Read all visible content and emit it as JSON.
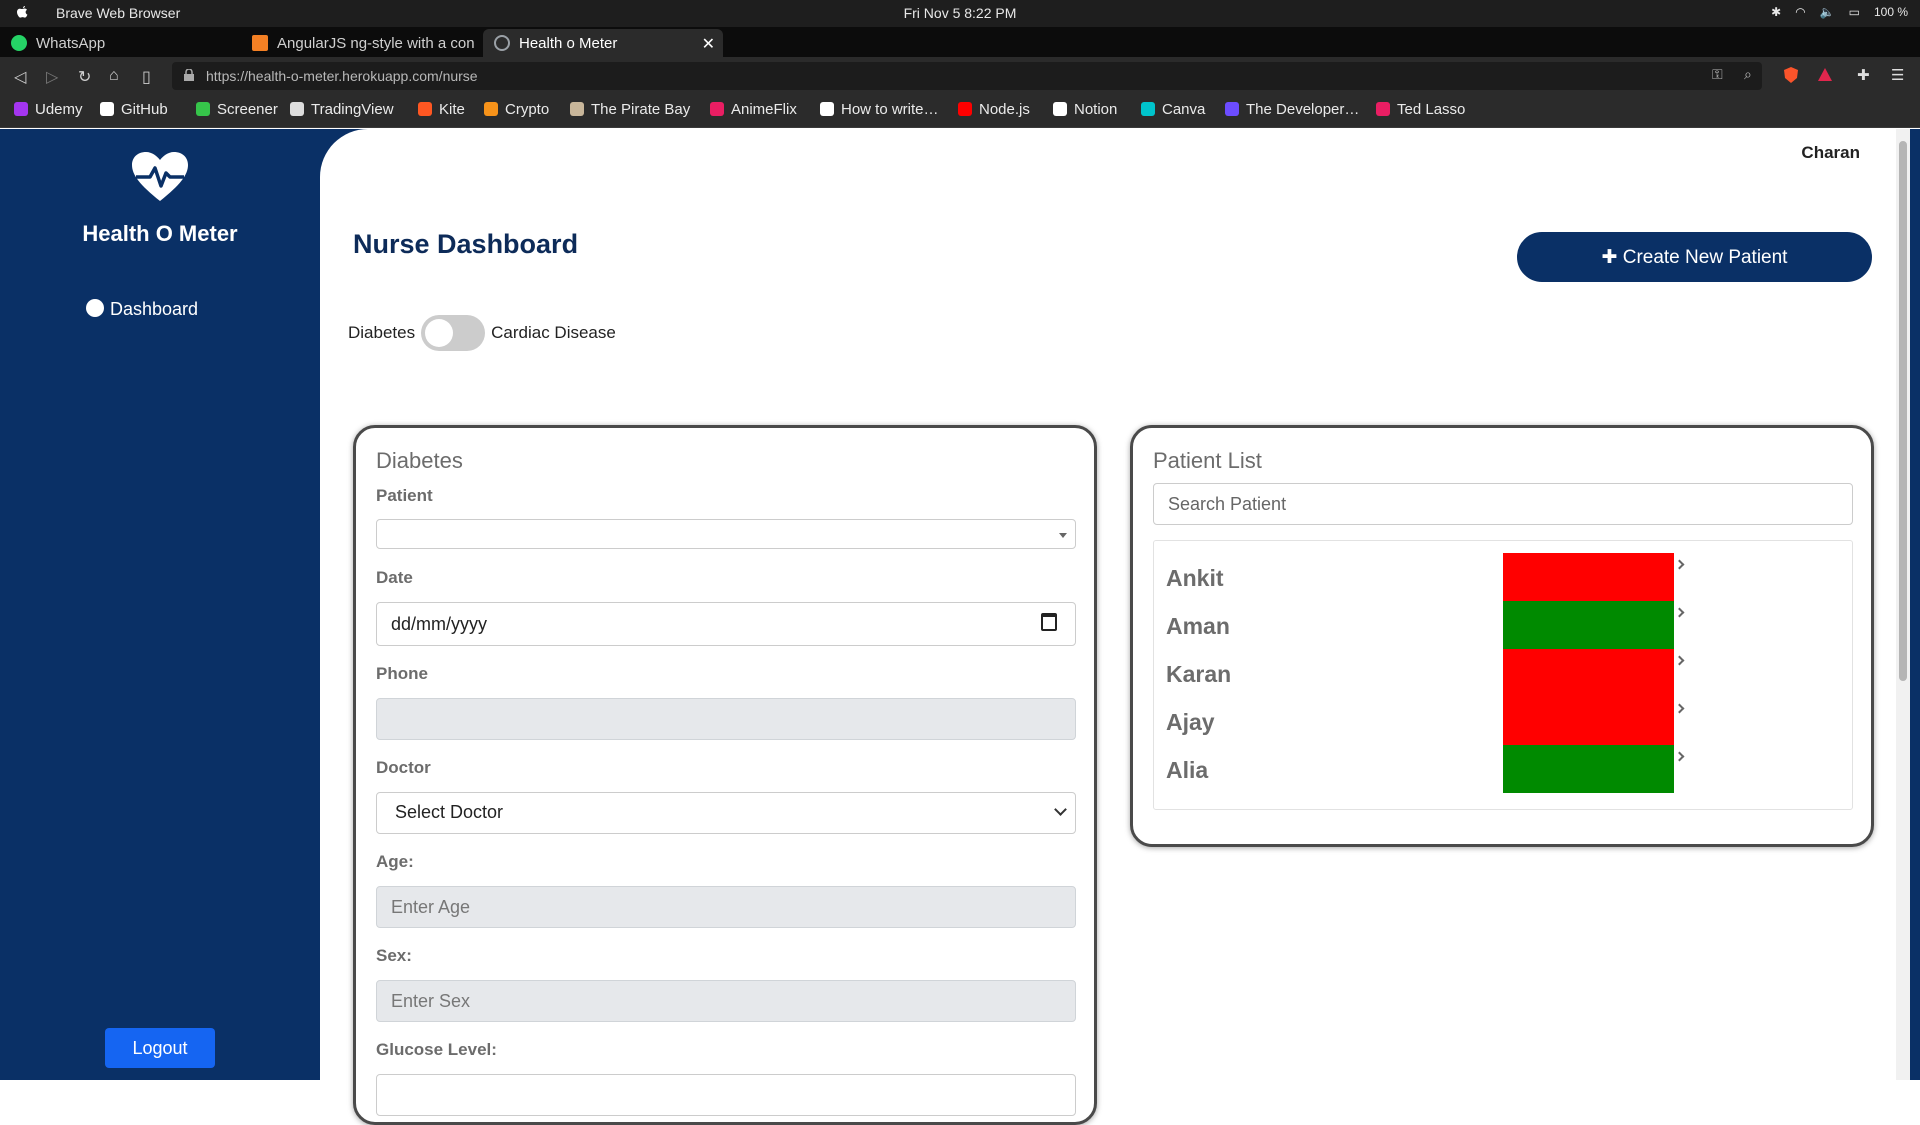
{
  "os_bar": {
    "app_name": "Brave Web Browser",
    "clock": "Fri Nov 5   8:22 PM",
    "battery": "100 %"
  },
  "tabs": [
    {
      "label": "WhatsApp",
      "icon": "whatsapp-icon",
      "color": "#25d366"
    },
    {
      "label": "AngularJS ng-style with a con",
      "icon": "stackoverflow-icon",
      "color": "#f48024"
    },
    {
      "label": "Health o Meter",
      "icon": "globe-icon",
      "color": "#9aa0a6"
    }
  ],
  "address_bar": {
    "url": "https://health-o-meter.herokuapp.com/nurse"
  },
  "bookmarks": [
    {
      "label": "Udemy",
      "color": "#a435f0"
    },
    {
      "label": "GitHub",
      "color": "#ffffff"
    },
    {
      "label": "Screener",
      "color": "#36c44a"
    },
    {
      "label": "TradingView",
      "color": "#dddddd"
    },
    {
      "label": "Kite",
      "color": "#ff5722"
    },
    {
      "label": "Crypto",
      "color": "#f7931a"
    },
    {
      "label": "The Pirate Bay",
      "color": "#c8b69a"
    },
    {
      "label": "AnimeFlix",
      "color": "#e91e63"
    },
    {
      "label": "How to write…",
      "color": "#ffffff"
    },
    {
      "label": "Node.js",
      "color": "#ff0000"
    },
    {
      "label": "Notion",
      "color": "#ffffff"
    },
    {
      "label": "Canva",
      "color": "#00c4cc"
    },
    {
      "label": "The Developer…",
      "color": "#6c4cff"
    },
    {
      "label": "Ted Lasso",
      "color": "#e91e63"
    }
  ],
  "sidebar": {
    "brand": "Health O Meter",
    "nav_dashboard": "Dashboard",
    "logout": "Logout"
  },
  "header": {
    "user": "Charan",
    "title": "Nurse Dashboard",
    "create_button": "Create New Patient"
  },
  "toggle": {
    "left_label": "Diabetes",
    "right_label": "Cardiac Disease",
    "state": "off"
  },
  "form": {
    "title": "Diabetes",
    "patient_label": "Patient",
    "patient_value": "",
    "date_label": "Date",
    "date_placeholder": "dd/mm/yyyy",
    "phone_label": "Phone",
    "phone_value": "",
    "doctor_label": "Doctor",
    "doctor_value": "Select Doctor",
    "age_label": "Age:",
    "age_placeholder": "Enter Age",
    "sex_label": "Sex:",
    "sex_placeholder": "Enter Sex",
    "glucose_label": "Glucose Level:"
  },
  "patient_list": {
    "title": "Patient List",
    "search_placeholder": "Search Patient",
    "patients": [
      {
        "name": "Ankit",
        "status_color": "#ff0000"
      },
      {
        "name": "Aman",
        "status_color": "#008a00"
      },
      {
        "name": "Karan",
        "status_color": "#ff0000"
      },
      {
        "name": "Ajay",
        "status_color": "#ff0000"
      },
      {
        "name": "Alia",
        "status_color": "#008a00"
      }
    ]
  },
  "colors": {
    "sidebar": "#0a3066",
    "accent": "#1565f2",
    "danger": "#ff0000",
    "success": "#008a00"
  }
}
